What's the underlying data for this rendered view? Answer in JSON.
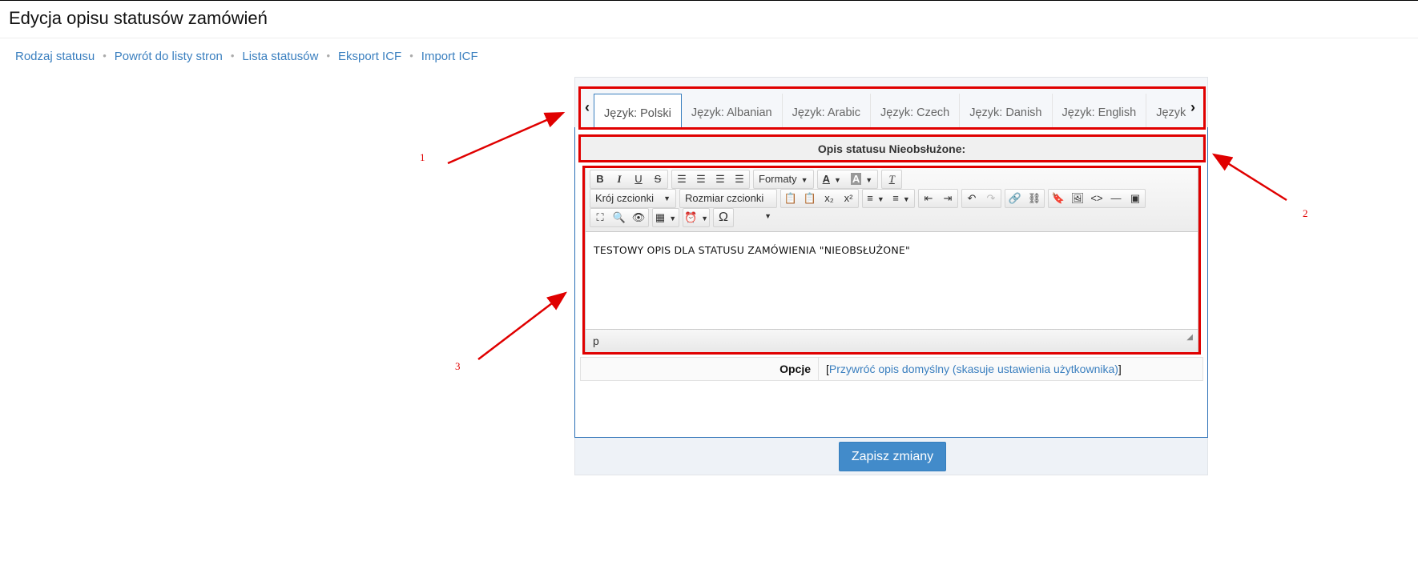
{
  "page": {
    "title": "Edycja opisu statusów zamówień"
  },
  "nav": [
    {
      "label": "Rodzaj statusu"
    },
    {
      "label": "Powrót do listy stron"
    },
    {
      "label": "Lista statusów"
    },
    {
      "label": "Eksport ICF"
    },
    {
      "label": "Import ICF"
    }
  ],
  "tabs": {
    "prev_icon": "chevron-left-icon",
    "next_icon": "chevron-right-icon",
    "items": [
      {
        "label": "Język: Polski",
        "active": true
      },
      {
        "label": "Język: Albanian"
      },
      {
        "label": "Język: Arabic"
      },
      {
        "label": "Język: Czech"
      },
      {
        "label": "Język: Danish"
      },
      {
        "label": "Język: English"
      },
      {
        "label": "Język: Finnish"
      }
    ]
  },
  "description_header": "Opis statusu Nieobsłużone:",
  "editor": {
    "toolbar": {
      "formats_label": "Formaty",
      "font_family_label": "Krój czcionki",
      "font_size_label": "Rozmiar czcionki"
    },
    "content": "TESTOWY OPIS DLA STATUSU ZAMÓWIENIA \"NIEOBSŁUŻONE\"",
    "status_path": "p"
  },
  "options": {
    "label": "Opcje",
    "bracket_open": "[",
    "link": "Przywróć opis domyślny (skasuje ustawienia użytkownika)",
    "bracket_close": "]"
  },
  "save_button": "Zapisz zmiany",
  "annotations": [
    "1",
    "2",
    "3"
  ],
  "colors": {
    "accent": "#428bca",
    "link": "#3a7fbf",
    "annotation": "#e00000"
  }
}
